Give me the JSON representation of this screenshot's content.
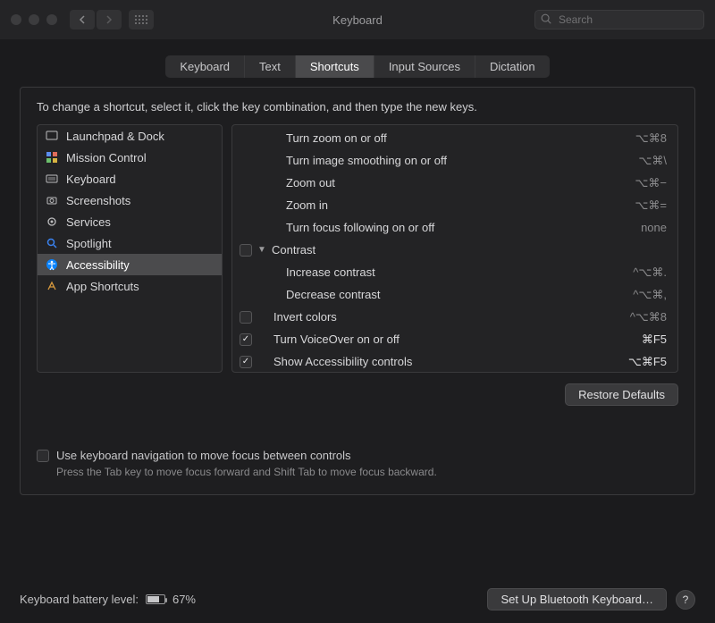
{
  "window": {
    "title": "Keyboard"
  },
  "search": {
    "placeholder": "Search"
  },
  "tabs": [
    {
      "label": "Keyboard",
      "active": false
    },
    {
      "label": "Text",
      "active": false
    },
    {
      "label": "Shortcuts",
      "active": true
    },
    {
      "label": "Input Sources",
      "active": false
    },
    {
      "label": "Dictation",
      "active": false
    }
  ],
  "hint": "To change a shortcut, select it, click the key combination, and then type the new keys.",
  "sidebar": {
    "items": [
      {
        "name": "launchpad-dock",
        "label": "Launchpad & Dock",
        "icon": "launchpad"
      },
      {
        "name": "mission-control",
        "label": "Mission Control",
        "icon": "mission"
      },
      {
        "name": "keyboard",
        "label": "Keyboard",
        "icon": "keyboard"
      },
      {
        "name": "screenshots",
        "label": "Screenshots",
        "icon": "screenshot"
      },
      {
        "name": "services",
        "label": "Services",
        "icon": "gear"
      },
      {
        "name": "spotlight",
        "label": "Spotlight",
        "icon": "spotlight"
      },
      {
        "name": "accessibility",
        "label": "Accessibility",
        "icon": "accessibility",
        "selected": true
      },
      {
        "name": "app-shortcuts",
        "label": "App Shortcuts",
        "icon": "app"
      }
    ]
  },
  "shortcuts": [
    {
      "type": "item",
      "indent": 2,
      "checked": null,
      "label": "Turn zoom on or off",
      "keys": "⌥⌘8"
    },
    {
      "type": "item",
      "indent": 2,
      "checked": null,
      "label": "Turn image smoothing on or off",
      "keys": "⌥⌘\\"
    },
    {
      "type": "item",
      "indent": 2,
      "checked": null,
      "label": "Zoom out",
      "keys": "⌥⌘−"
    },
    {
      "type": "item",
      "indent": 2,
      "checked": null,
      "label": "Zoom in",
      "keys": "⌥⌘="
    },
    {
      "type": "item",
      "indent": 2,
      "checked": null,
      "label": "Turn focus following on or off",
      "keys": "none"
    },
    {
      "type": "group",
      "indent": 0,
      "checked": false,
      "label": "Contrast",
      "keys": ""
    },
    {
      "type": "item",
      "indent": 2,
      "checked": null,
      "label": "Increase contrast",
      "keys": "^⌥⌘."
    },
    {
      "type": "item",
      "indent": 2,
      "checked": null,
      "label": "Decrease contrast",
      "keys": "^⌥⌘,"
    },
    {
      "type": "item",
      "indent": 1,
      "checked": false,
      "label": "Invert colors",
      "keys": "^⌥⌘8"
    },
    {
      "type": "item",
      "indent": 1,
      "checked": true,
      "label": "Turn VoiceOver on or off",
      "keys": "⌘F5",
      "bright": true
    },
    {
      "type": "item",
      "indent": 1,
      "checked": true,
      "label": "Show Accessibility controls",
      "keys": "⌥⌘F5",
      "bright": true
    }
  ],
  "buttons": {
    "restore_defaults": "Restore Defaults",
    "bluetooth": "Set Up Bluetooth Keyboard…",
    "help": "?"
  },
  "kbnav": {
    "label": "Use keyboard navigation to move focus between controls",
    "sub": "Press the Tab key to move focus forward and Shift Tab to move focus backward."
  },
  "battery": {
    "label": "Keyboard battery level:",
    "percent": "67%"
  }
}
